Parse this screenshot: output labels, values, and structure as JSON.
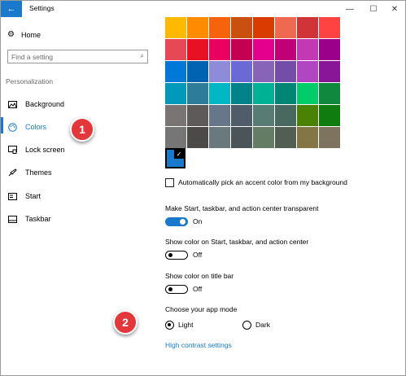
{
  "window": {
    "title": "Settings",
    "back_icon": "←",
    "minimize": "—",
    "maximize": "☐",
    "close": "✕"
  },
  "sidebar": {
    "home_label": "Home",
    "search_placeholder": "Find a setting",
    "section_label": "Personalization",
    "items": [
      {
        "label": "Background",
        "icon": "picture-icon"
      },
      {
        "label": "Colors",
        "icon": "palette-icon",
        "active": true
      },
      {
        "label": "Lock screen",
        "icon": "lock-screen-icon"
      },
      {
        "label": "Themes",
        "icon": "brush-icon"
      },
      {
        "label": "Start",
        "icon": "start-icon"
      },
      {
        "label": "Taskbar",
        "icon": "taskbar-icon"
      }
    ]
  },
  "callouts": {
    "one": "1",
    "two": "2"
  },
  "colors": {
    "accent": "#1979ca",
    "palette": [
      "#ffb900",
      "#ff8c00",
      "#f7630c",
      "#ca5010",
      "#da3b01",
      "#ef6950",
      "#d13438",
      "#ff4343",
      "#e74856",
      "#e81123",
      "#ea005e",
      "#c30052",
      "#e3008c",
      "#bf0077",
      "#c239b3",
      "#9a0089",
      "#0078d7",
      "#0063b1",
      "#8e8cd8",
      "#6b69d6",
      "#8764b8",
      "#744da9",
      "#b146c2",
      "#881798",
      "#0099bc",
      "#2d7d9a",
      "#00b7c3",
      "#038387",
      "#00b294",
      "#018574",
      "#00cc6a",
      "#10893e",
      "#7a7574",
      "#5d5a58",
      "#68768a",
      "#515c6b",
      "#567c73",
      "#486860",
      "#498205",
      "#107c10",
      "#767676",
      "#4c4a48",
      "#69797e",
      "#4a5459",
      "#647c64",
      "#525e54",
      "#847545",
      "#7e735f"
    ],
    "auto_pick_label": "Automatically pick an accent color from my background",
    "transparent_label": "Make Start, taskbar, and action center transparent",
    "transparent_state": "On",
    "show_start_label": "Show color on Start, taskbar, and action center",
    "show_start_state": "Off",
    "title_bar_label": "Show color on title bar",
    "title_bar_state": "Off",
    "app_mode_label": "Choose your app mode",
    "mode_light": "Light",
    "mode_dark": "Dark",
    "selected_mode": "Light",
    "high_contrast_link": "High contrast settings"
  }
}
